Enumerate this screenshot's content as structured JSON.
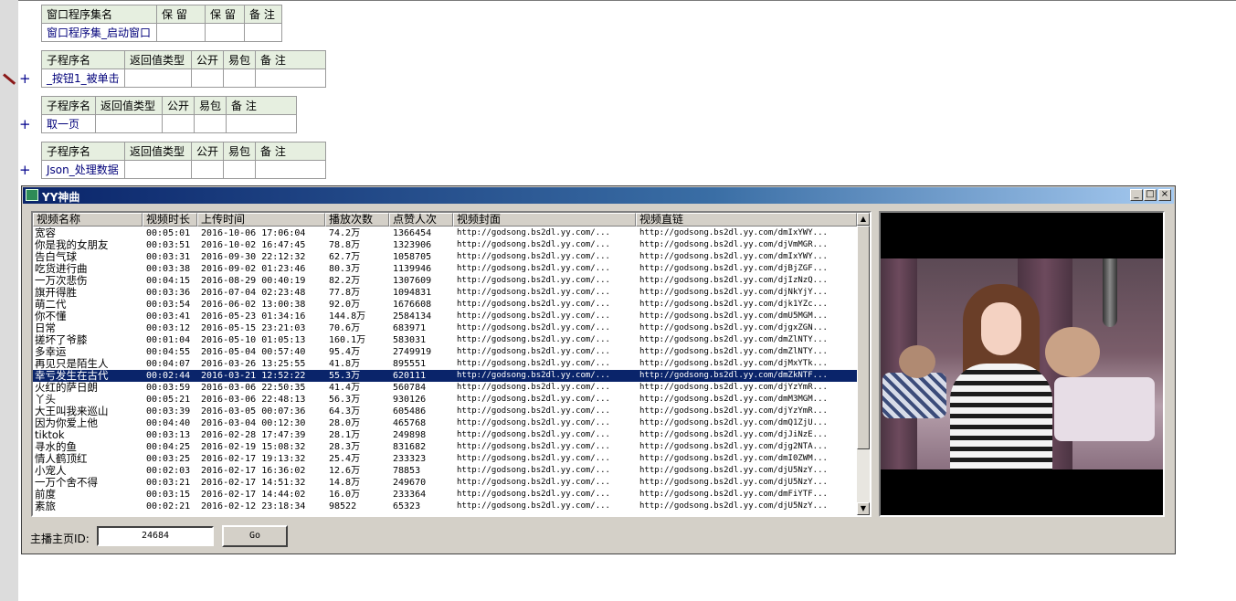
{
  "code": {
    "assembly": {
      "headers": [
        "窗口程序集名",
        "保 留",
        "保 留",
        "备 注"
      ],
      "values": [
        "窗口程序集_启动窗口",
        "",
        "",
        ""
      ]
    },
    "subs": [
      {
        "headers": [
          "子程序名",
          "返回值类型",
          "公开",
          "易包",
          "备 注"
        ],
        "values": [
          "_按钮1_被单击",
          "",
          "",
          "",
          ""
        ],
        "plus": "+"
      },
      {
        "headers": [
          "子程序名",
          "返回值类型",
          "公开",
          "易包",
          "备 注"
        ],
        "values": [
          "取一页",
          "",
          "",
          "",
          ""
        ],
        "plus": "+"
      },
      {
        "headers": [
          "子程序名",
          "返回值类型",
          "公开",
          "易包",
          "备 注"
        ],
        "values": [
          "Json_处理数据",
          "",
          "",
          "",
          ""
        ],
        "plus": "+"
      }
    ]
  },
  "window": {
    "title": "YY神曲",
    "minimize": "_",
    "maximize": "□",
    "close": "×"
  },
  "list": {
    "columns": [
      "视频名称",
      "视频时长",
      "上传时间",
      "播放次数",
      "点赞人次",
      "视频封面",
      "视频直链"
    ],
    "rows": [
      [
        "宽容",
        "00:05:01",
        "2016-10-06 17:06:04",
        "74.2万",
        "1366454",
        "http://godsong.bs2dl.yy.com/...",
        "http://godsong.bs2dl.yy.com/dmIxYWY..."
      ],
      [
        "你是我的女朋友",
        "00:03:51",
        "2016-10-02 16:47:45",
        "78.8万",
        "1323906",
        "http://godsong.bs2dl.yy.com/...",
        "http://godsong.bs2dl.yy.com/djVmMGR..."
      ],
      [
        "告白气球",
        "00:03:31",
        "2016-09-30 22:12:32",
        "62.7万",
        "1058705",
        "http://godsong.bs2dl.yy.com/...",
        "http://godsong.bs2dl.yy.com/dmIxYWY..."
      ],
      [
        "吃货进行曲",
        "00:03:38",
        "2016-09-02 01:23:46",
        "80.3万",
        "1139946",
        "http://godsong.bs2dl.yy.com/...",
        "http://godsong.bs2dl.yy.com/djBjZGF..."
      ],
      [
        "一万次悲伤",
        "00:04:15",
        "2016-08-29 00:40:19",
        "82.2万",
        "1307609",
        "http://godsong.bs2dl.yy.com/...",
        "http://godsong.bs2dl.yy.com/djIzNzQ..."
      ],
      [
        "旗开得胜",
        "00:03:36",
        "2016-07-04 02:23:48",
        "77.8万",
        "1094831",
        "http://godsong.bs2dl.yy.com/...",
        "http://godsong.bs2dl.yy.com/djNkYjY..."
      ],
      [
        "萌二代",
        "00:03:54",
        "2016-06-02 13:00:38",
        "92.0万",
        "1676608",
        "http://godsong.bs2dl.yy.com/...",
        "http://godsong.bs2dl.yy.com/djk1YZc..."
      ],
      [
        "你不懂",
        "00:03:41",
        "2016-05-23 01:34:16",
        "144.8万",
        "2584134",
        "http://godsong.bs2dl.yy.com/...",
        "http://godsong.bs2dl.yy.com/dmU5MGM..."
      ],
      [
        "日常",
        "00:03:12",
        "2016-05-15 23:21:03",
        "70.6万",
        "683971",
        "http://godsong.bs2dl.yy.com/...",
        "http://godsong.bs2dl.yy.com/djgxZGN..."
      ],
      [
        "搓坏了爷膝",
        "00:01:04",
        "2016-05-10 01:05:13",
        "160.1万",
        "583031",
        "http://godsong.bs2dl.yy.com/...",
        "http://godsong.bs2dl.yy.com/dmZlNTY..."
      ],
      [
        "多幸运",
        "00:04:55",
        "2016-05-04 00:57:40",
        "95.4万",
        "2749919",
        "http://godsong.bs2dl.yy.com/...",
        "http://godsong.bs2dl.yy.com/dmZlNTY..."
      ],
      [
        "再见只是陌生人",
        "00:04:07",
        "2016-03-26 13:25:55",
        "41.8万",
        "895551",
        "http://godsong.bs2dl.yy.com/...",
        "http://godsong.bs2dl.yy.com/djMxYTk..."
      ],
      [
        "幸亏发生在古代",
        "00:02:44",
        "2016-03-21 12:52:22",
        "55.3万",
        "620111",
        "http://godsong.bs2dl.yy.com/...",
        "http://godsong.bs2dl.yy.com/dmZkNTF..."
      ],
      [
        "火红的萨日朗",
        "00:03:59",
        "2016-03-06 22:50:35",
        "41.4万",
        "560784",
        "http://godsong.bs2dl.yy.com/...",
        "http://godsong.bs2dl.yy.com/djYzYmR..."
      ],
      [
        "丫头",
        "00:05:21",
        "2016-03-06 22:48:13",
        "56.3万",
        "930126",
        "http://godsong.bs2dl.yy.com/...",
        "http://godsong.bs2dl.yy.com/dmM3MGM..."
      ],
      [
        "大王叫我来巡山",
        "00:03:39",
        "2016-03-05 00:07:36",
        "64.3万",
        "605486",
        "http://godsong.bs2dl.yy.com/...",
        "http://godsong.bs2dl.yy.com/djYzYmR..."
      ],
      [
        "因为你爱上他",
        "00:04:40",
        "2016-03-04 00:12:30",
        "28.0万",
        "465768",
        "http://godsong.bs2dl.yy.com/...",
        "http://godsong.bs2dl.yy.com/dmQ1ZjU..."
      ],
      [
        "tiktok",
        "00:03:13",
        "2016-02-28 17:47:39",
        "28.1万",
        "249898",
        "http://godsong.bs2dl.yy.com/...",
        "http://godsong.bs2dl.yy.com/djJiNzE..."
      ],
      [
        "寻水的鱼",
        "00:04:25",
        "2016-02-19 15:08:32",
        "28.3万",
        "831682",
        "http://godsong.bs2dl.yy.com/...",
        "http://godsong.bs2dl.yy.com/djg2NTA..."
      ],
      [
        "情人鹤顶红",
        "00:03:25",
        "2016-02-17 19:13:32",
        "25.4万",
        "233323",
        "http://godsong.bs2dl.yy.com/...",
        "http://godsong.bs2dl.yy.com/dmI0ZWM..."
      ],
      [
        "小宠人",
        "00:02:03",
        "2016-02-17 16:36:02",
        "12.6万",
        "78853",
        "http://godsong.bs2dl.yy.com/...",
        "http://godsong.bs2dl.yy.com/djU5NzY..."
      ],
      [
        "一万个舍不得",
        "00:03:21",
        "2016-02-17 14:51:32",
        "14.8万",
        "249670",
        "http://godsong.bs2dl.yy.com/...",
        "http://godsong.bs2dl.yy.com/djU5NzY..."
      ],
      [
        "前度",
        "00:03:15",
        "2016-02-17 14:44:02",
        "16.0万",
        "233364",
        "http://godsong.bs2dl.yy.com/...",
        "http://godsong.bs2dl.yy.com/dmFiYTF..."
      ],
      [
        "素旅",
        "00:02:21",
        "2016-02-12 23:18:34",
        "98522",
        "65323",
        "http://godsong.bs2dl.yy.com/...",
        "http://godsong.bs2dl.yy.com/djU5NzY..."
      ]
    ],
    "selected_index": 12,
    "scroll_up": "▲",
    "scroll_down": "▼"
  },
  "controls": {
    "id_label": "主播主页ID:",
    "id_value": "24684",
    "go_label": "Go"
  },
  "colors": {
    "selection": "#0a246a",
    "title_start": "#0a246a",
    "title_end": "#a6caf0",
    "header_green": "#e6efe0"
  }
}
